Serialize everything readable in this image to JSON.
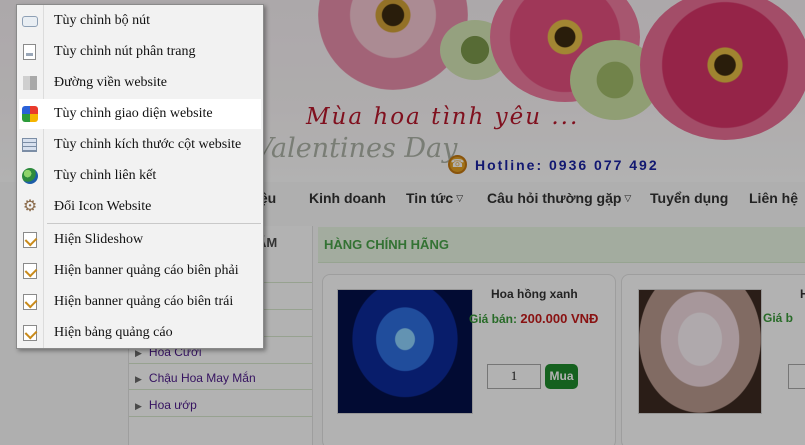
{
  "banner": {
    "slogan": "Mùa hoa tình yêu ...",
    "script_text": "Valentines Day",
    "hotline": "Hotline: 0936 077 492"
  },
  "nav": {
    "items": [
      {
        "label": "iệu"
      },
      {
        "label": "Kinh doanh"
      },
      {
        "label": "Tin tức"
      },
      {
        "label": "Câu hỏi thường gặp"
      },
      {
        "label": "Tuyển dụng"
      },
      {
        "label": "Liên hệ"
      }
    ]
  },
  "left_col": {
    "heading": "ẨM",
    "items": [
      {
        "label": "Hoa Cưới"
      },
      {
        "label": "Chậu Hoa May Mắn"
      },
      {
        "label": "Hoa ướp"
      }
    ]
  },
  "products": {
    "heading": "HÀNG CHÍNH HÃNG",
    "price_label": "Giá bán:",
    "cards": [
      {
        "name": "Hoa hồng xanh",
        "price": "200.000 VNĐ",
        "qty": "1",
        "buy_label": "Mua"
      },
      {
        "name": "H",
        "price_label": "Giá b"
      }
    ]
  },
  "menu": {
    "items": [
      {
        "label": "Tùy chỉnh bộ nút",
        "icon": "button-shape-icon"
      },
      {
        "label": "Tùy chỉnh nút phân trang",
        "icon": "pagination-icon"
      },
      {
        "label": "Đường viền website",
        "icon": "border-icon"
      },
      {
        "label": "Tùy chỉnh giao diện website",
        "icon": "theme-palette-icon",
        "highlighted": true
      },
      {
        "label": "Tùy chỉnh kích thước cột website",
        "icon": "column-size-icon"
      },
      {
        "label": "Tùy chỉnh liên kết",
        "icon": "globe-link-icon"
      },
      {
        "label": "Đổi Icon Website",
        "icon": "gear-icon"
      },
      {
        "label": "Hiện Slideshow",
        "icon": "checkbox-checked-icon"
      },
      {
        "label": "Hiện banner quảng cáo biên phải",
        "icon": "checkbox-checked-icon"
      },
      {
        "label": "Hiện banner quảng cáo biên trái",
        "icon": "checkbox-checked-icon"
      },
      {
        "label": "Hiện bảng quảng cáo",
        "icon": "checkbox-checked-icon"
      }
    ]
  },
  "colors": {
    "menu_bg": "#f2f2f2",
    "menu_highlight": "#ffffff",
    "hotline": "#1a23a3",
    "price": "#c41a1a",
    "buy_button": "#1f8c2d",
    "section_heading": "#4aa44a"
  }
}
